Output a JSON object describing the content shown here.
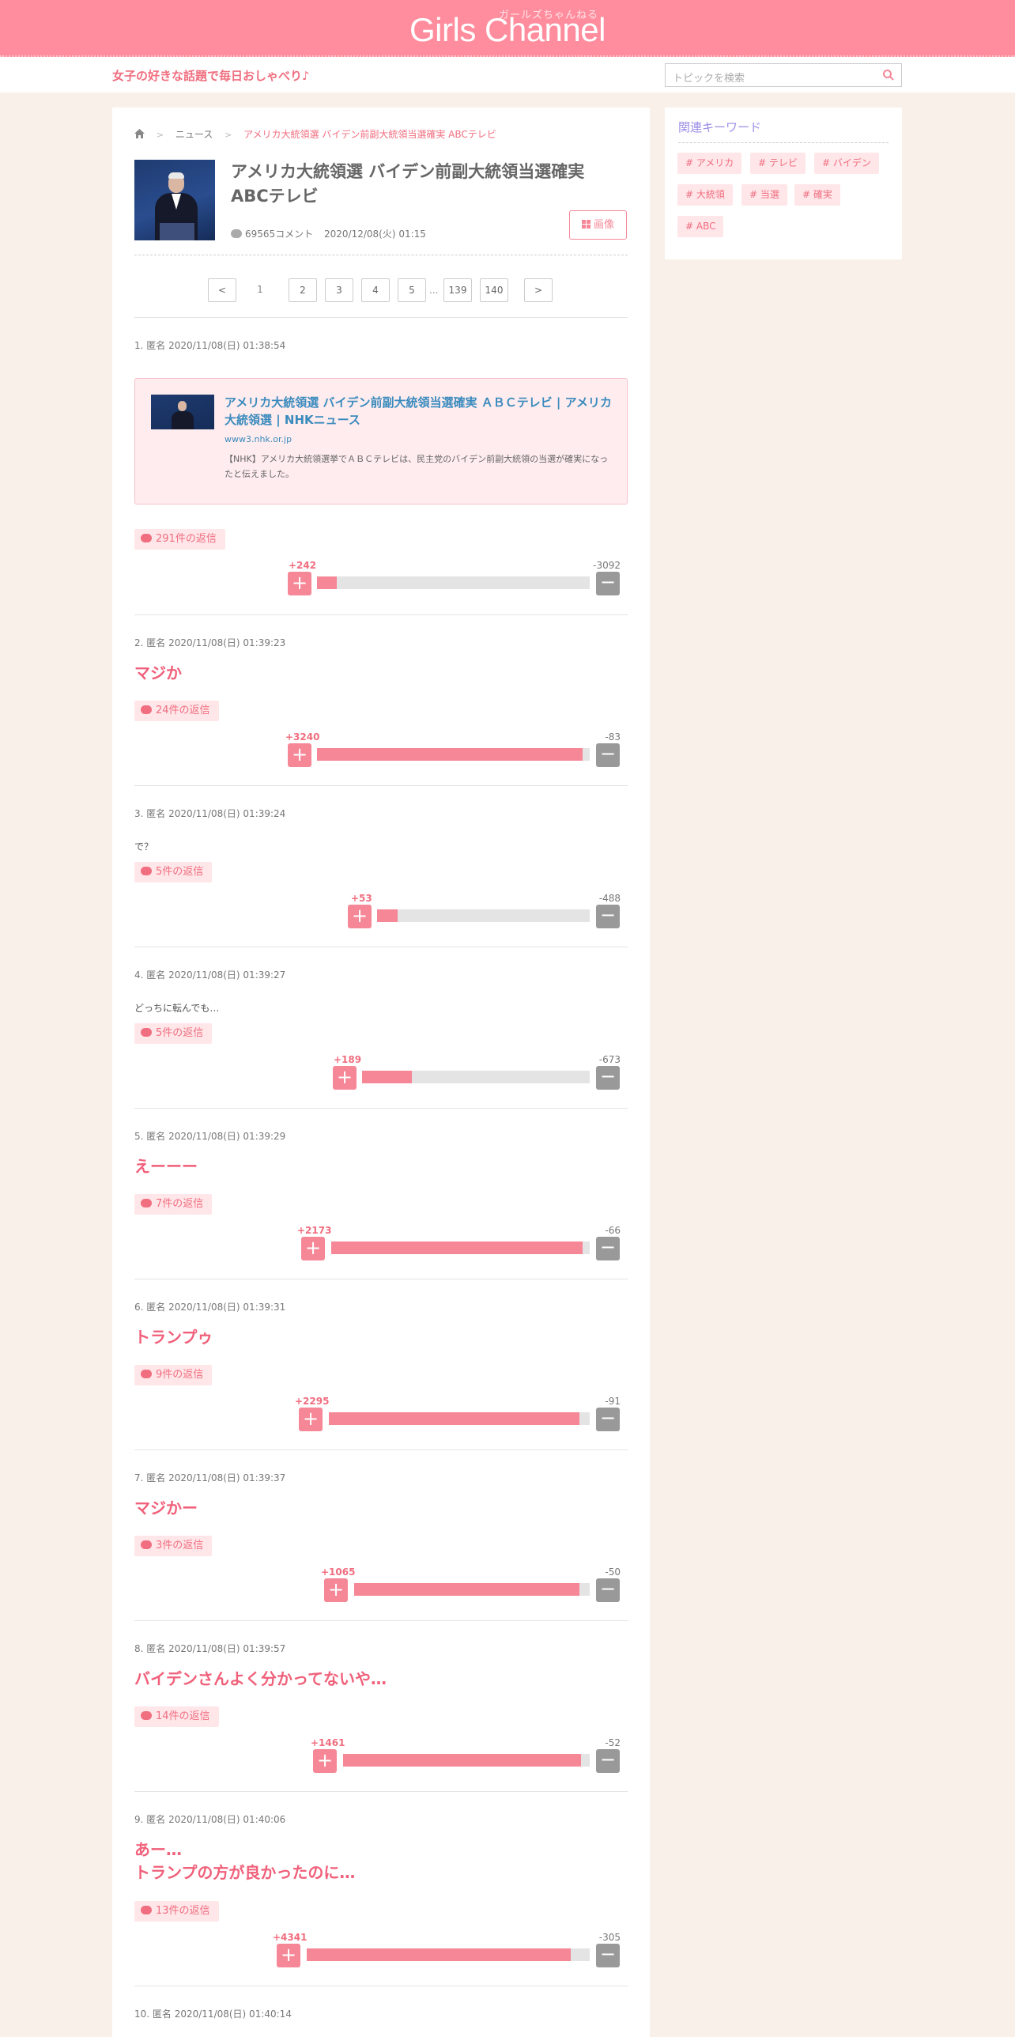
{
  "site": {
    "logo_kana": "ガールズちゃんねる",
    "logo": "Girls Channel",
    "tagline": "女子の好きな話題で毎日おしゃべり♪",
    "search_placeholder": "トピックを検索"
  },
  "breadcrumb": {
    "section": "ニュース",
    "current": "アメリカ大統領選 バイデン前副大統領当選確実 ABCテレビ"
  },
  "article": {
    "title": "アメリカ大統領選 バイデン前副大統領当選確実 ABCテレビ",
    "comment_count": "69565コメント",
    "date": "2020/12/08(火) 01:15",
    "image_button": "画像"
  },
  "pager": {
    "pages": [
      "1",
      "2",
      "3",
      "4",
      "5",
      "139",
      "140"
    ],
    "current": "1",
    "ellipsis": "..."
  },
  "embed": {
    "title": "アメリカ大統領選 バイデン前副大統領当選確実 ＡＢＣテレビ | アメリカ大統領選 | NHKニュース",
    "url": "www3.nhk.or.jp",
    "description": "【NHK】アメリカ大統領選挙でＡＢＣテレビは、民主党のバイデン前副大統領の当選が確実になったと伝えました。"
  },
  "comments": [
    {
      "header": "1. 匿名 2020/11/08(日) 01:38:54",
      "body": "",
      "replies": "291件の返信",
      "plus": "+242",
      "minus": "-3092",
      "plus_ratio": 0.073
    },
    {
      "header": "2. 匿名 2020/11/08(日) 01:39:23",
      "body": "マジか",
      "replies": "24件の返信",
      "plus": "+3240",
      "minus": "-83",
      "plus_ratio": 0.975
    },
    {
      "header": "3. 匿名 2020/11/08(日) 01:39:24",
      "body": "で？",
      "replies": "5件の返信",
      "plus": "+53",
      "minus": "-488",
      "plus_ratio": 0.098
    },
    {
      "header": "4. 匿名 2020/11/08(日) 01:39:27",
      "body": "どっちに転んでも…",
      "replies": "5件の返信",
      "plus": "+189",
      "minus": "-673",
      "plus_ratio": 0.219
    },
    {
      "header": "5. 匿名 2020/11/08(日) 01:39:29",
      "body": "えーーー",
      "replies": "7件の返信",
      "plus": "+2173",
      "minus": "-66",
      "plus_ratio": 0.971
    },
    {
      "header": "6. 匿名 2020/11/08(日) 01:39:31",
      "body": "トランプゥ",
      "replies": "9件の返信",
      "plus": "+2295",
      "minus": "-91",
      "plus_ratio": 0.962
    },
    {
      "header": "7. 匿名 2020/11/08(日) 01:39:37",
      "body": "マジかー",
      "replies": "3件の返信",
      "plus": "+1065",
      "minus": "-50",
      "plus_ratio": 0.955
    },
    {
      "header": "8. 匿名 2020/11/08(日) 01:39:57",
      "body": "バイデンさんよく分かってないや…",
      "replies": "14件の返信",
      "plus": "+1461",
      "minus": "-52",
      "plus_ratio": 0.966
    },
    {
      "header": "9. 匿名 2020/11/08(日) 01:40:06",
      "body": "あー…",
      "body2": "トランプの方が良かったのに…",
      "replies": "13件の返信",
      "plus": "+4341",
      "minus": "-305",
      "plus_ratio": 0.934
    },
    {
      "header": "10. 匿名 2020/11/08(日) 01:40:14"
    }
  ],
  "sidebar": {
    "title": "関連キーワード",
    "keywords": [
      "# アメリカ",
      "# テレビ",
      "# バイデン",
      "# 大統領",
      "# 当選",
      "# 確実",
      "# ABC"
    ]
  }
}
